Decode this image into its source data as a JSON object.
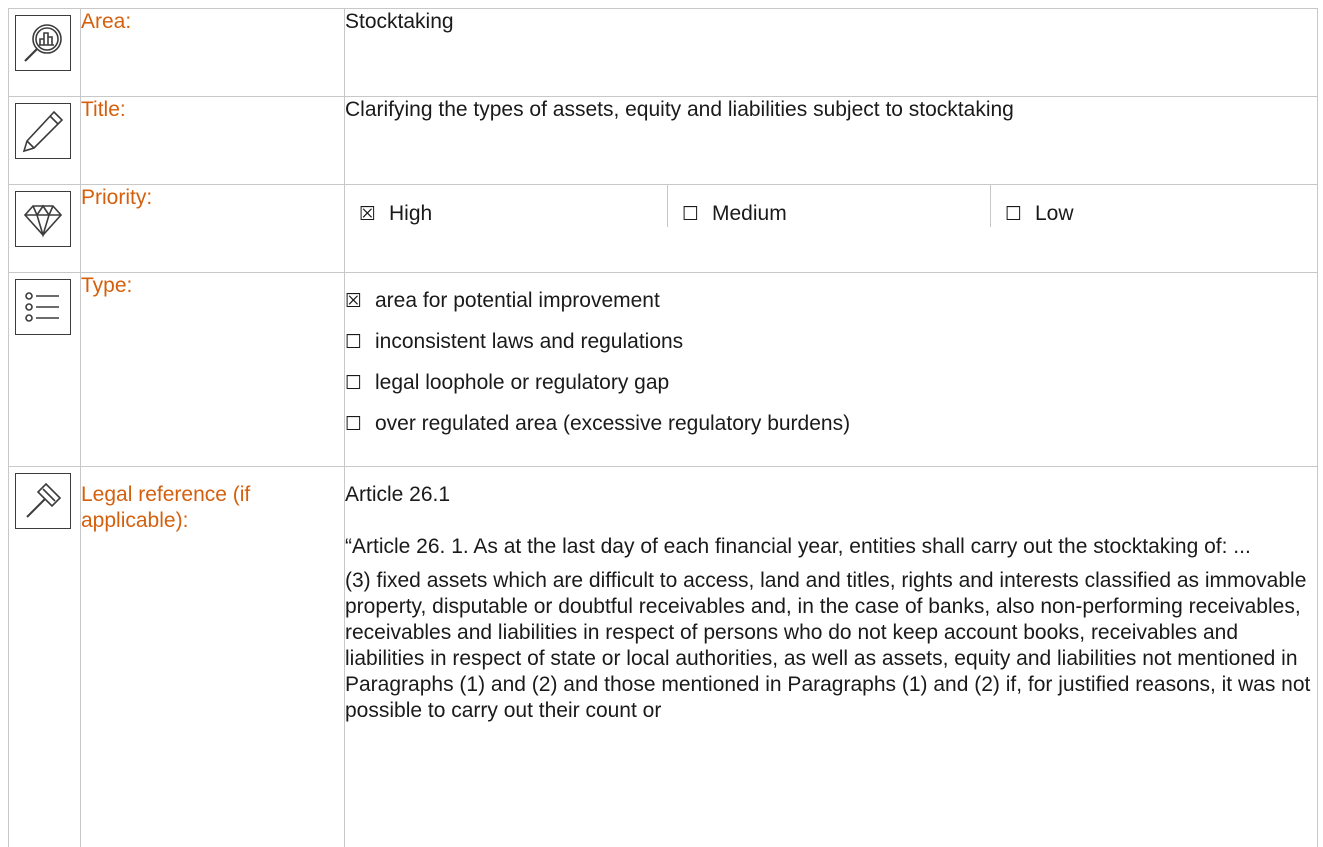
{
  "rows": {
    "area": {
      "label": "Area:",
      "value": "Stocktaking",
      "icon": "magnifier-chart-icon"
    },
    "title": {
      "label": "Title:",
      "value": "Clarifying the types of assets, equity and liabilities subject to stocktaking",
      "icon": "pencil-icon"
    },
    "priority": {
      "label": "Priority:",
      "icon": "diamond-icon",
      "options": [
        {
          "box": "☒",
          "label": "High"
        },
        {
          "box": "☐",
          "label": "Medium"
        },
        {
          "box": "☐",
          "label": "Low"
        }
      ]
    },
    "type": {
      "label": "Type:",
      "icon": "list-icon",
      "options": [
        {
          "box": "☒",
          "label": "area for potential improvement"
        },
        {
          "box": "☐",
          "label": "inconsistent laws and regulations"
        },
        {
          "box": "☐",
          "label": "legal loophole or regulatory gap"
        },
        {
          "box": "☐",
          "label": "over regulated area (excessive regulatory burdens)"
        }
      ]
    },
    "legal": {
      "label": "Legal reference (if applicable):",
      "icon": "gavel-icon",
      "reference": "Article 26.1",
      "quote_intro": "“Article 26. 1. As at the last day of each financial year, entities shall carry out the stocktaking of: ...",
      "quote_body": "(3) fixed assets which are difficult to access, land and titles, rights and interests classified as immovable property, disputable or doubtful receivables and, in the case of banks, also non-performing receivables, receivables and liabilities in respect of persons who do not keep account books, receivables and liabilities in respect of state or local authorities, as well as assets, equity and liabilities not mentioned in Paragraphs (1) and (2) and those mentioned in Paragraphs (1) and (2) if, for justified reasons, it was not possible to carry out their count or"
    }
  }
}
